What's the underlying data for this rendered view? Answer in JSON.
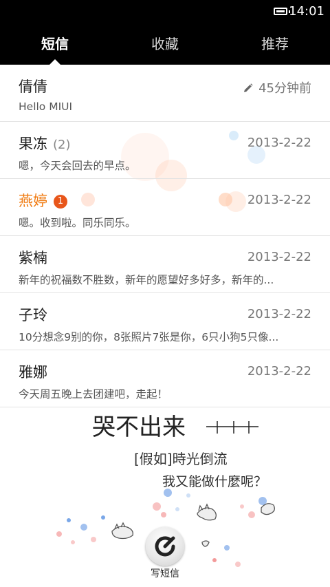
{
  "status": {
    "time": "14:01"
  },
  "tabs": [
    {
      "label": "短信"
    },
    {
      "label": "收藏"
    },
    {
      "label": "推荐"
    }
  ],
  "conversations": [
    {
      "name": "倩倩",
      "preview": "Hello MIUI",
      "date": "45分钟前",
      "draft": true
    },
    {
      "name": "果冻",
      "count": "(2)",
      "preview": "嗯，今天会回去的早点。",
      "date": "2013-2-22"
    },
    {
      "name": "燕婷",
      "badge": "1",
      "preview": "嗯。收到啦。同乐同乐。",
      "date": "2013-2-22",
      "unread": true
    },
    {
      "name": "紫楠",
      "preview": "新年的祝福数不胜数，新年的愿望好多好多，新年的...",
      "date": "2013-2-22"
    },
    {
      "name": "子玲",
      "preview": "10分想念9别的你，8张照片7张是你，6只小狗5只像...",
      "date": "2013-2-22"
    },
    {
      "name": "雅娜",
      "preview": "今天周五晚上去团建吧，走起！",
      "date": "2013-2-22"
    }
  ],
  "wallpaper": {
    "line1": "哭不出来",
    "line2": "[假如]時光倒流",
    "line3": "我又能做什麼呢？"
  },
  "compose": {
    "label": "写短信"
  },
  "colors": {
    "accent": "#f07a0f",
    "badge": "#e8561a",
    "header": "#000000"
  }
}
